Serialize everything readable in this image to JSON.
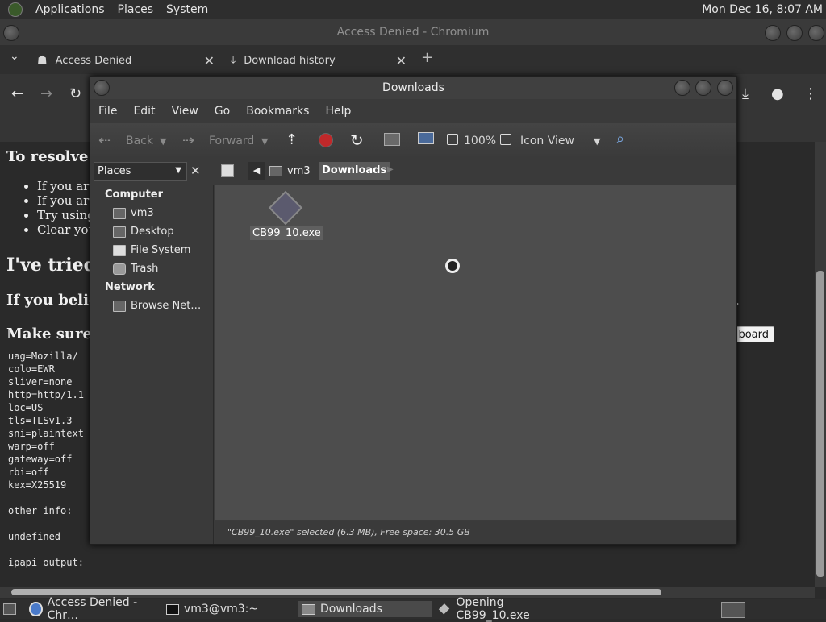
{
  "top_panel": {
    "menus": [
      "Applications",
      "Places",
      "System"
    ],
    "clock": "Mon Dec 16,  8:07 AM"
  },
  "chromium": {
    "window_title": "Access Denied - Chromium",
    "tabs": [
      {
        "label": "Access Denied",
        "icon": "robot-icon"
      },
      {
        "label": "Download history",
        "icon": "download-icon"
      }
    ],
    "new_tab_symbol": "+",
    "page": {
      "resolve_heading": "To resolve th",
      "bullets": [
        "If you are",
        "If you are",
        "Try using",
        "Clear you"
      ],
      "tried_heading": "I've tried a",
      "believe_heading": "If you believe",
      "make_sure_heading": "Make sure to",
      "clipboard_button": "board",
      "trailing_dot": ".",
      "trace_lines": [
        "uag=Mozilla/",
        "colo=EWR",
        "sliver=none",
        "http=http/1.1",
        "loc=US",
        "tls=TLSv1.3",
        "sni=plaintext",
        "warp=off",
        "gateway=off",
        "rbi=off",
        "kex=X25519",
        "",
        "other info:",
        "",
        "undefined",
        "",
        "ipapi output:"
      ]
    }
  },
  "file_manager": {
    "title": "Downloads",
    "menu": [
      "File",
      "Edit",
      "View",
      "Go",
      "Bookmarks",
      "Help"
    ],
    "toolbar": {
      "back": "Back",
      "forward": "Forward",
      "zoom": "100%",
      "view_mode": "Icon View"
    },
    "sidebar_selector": "Places",
    "path": [
      "vm3",
      "Downloads"
    ],
    "sidebar": {
      "computer_heading": "Computer",
      "computer_items": [
        "vm3",
        "Desktop",
        "File System",
        "Trash"
      ],
      "network_heading": "Network",
      "network_items": [
        "Browse Net…"
      ]
    },
    "files": [
      {
        "name": "CB99_10.exe"
      }
    ],
    "status": "\"CB99_10.exe\" selected (6.3 MB), Free space: 30.5 GB"
  },
  "taskbar": {
    "items": [
      {
        "label": "Access Denied - Chr…",
        "icon": "chromium-icon"
      },
      {
        "label": "vm3@vm3:~",
        "icon": "terminal-icon"
      },
      {
        "label": "Downloads",
        "icon": "folder-icon"
      },
      {
        "label": "Opening CB99_10.exe",
        "icon": "package-icon"
      }
    ]
  }
}
